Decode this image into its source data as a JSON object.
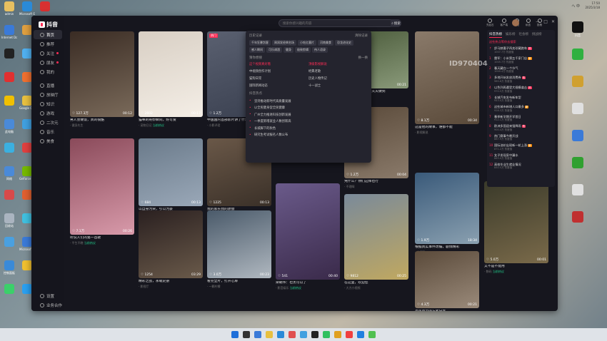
{
  "desktop": {
    "left_icons": [
      {
        "label": "admin",
        "color": "#e8c060"
      },
      {
        "label": "Internet Downlo",
        "color": "#3a7ad8"
      },
      {
        "label": "",
        "color": "#222"
      },
      {
        "label": "",
        "color": "#e03030"
      },
      {
        "label": "",
        "color": "#f0c000"
      },
      {
        "label": "此电脑",
        "color": "#4a8ad8"
      },
      {
        "label": "",
        "color": "#3bb0e0"
      },
      {
        "label": "网络",
        "color": "#4a8ad8"
      },
      {
        "label": "",
        "color": "#d84a4a"
      },
      {
        "label": "回收站",
        "color": "#aab4c0"
      },
      {
        "label": "",
        "color": "#4aa0e0"
      },
      {
        "label": "控制面板",
        "color": "#3a8ad8"
      },
      {
        "label": "",
        "color": "#3bd06a"
      },
      {
        "label": "Microsoft Edge",
        "color": "#2a8ad8"
      },
      {
        "label": "",
        "color": "#e0a040"
      },
      {
        "label": "",
        "color": "#50b0f0"
      },
      {
        "label": "",
        "color": "#f07030"
      },
      {
        "label": "Google Chrome",
        "color": "#e8c040"
      },
      {
        "label": "",
        "color": "#40a0e0"
      },
      {
        "label": "",
        "color": "#e04040"
      },
      {
        "label": "GeForce Experience",
        "color": "#76b900"
      },
      {
        "label": "",
        "color": "#e06030"
      },
      {
        "label": "",
        "color": "#40c0e0"
      },
      {
        "label": "Microsoft Store",
        "color": "#3a7ad8"
      },
      {
        "label": "",
        "color": "#f0c030"
      },
      {
        "label": "",
        "color": "#2aa0f0"
      },
      {
        "label": "",
        "color": "#d83030"
      },
      {
        "label": "",
        "color": "#e0e0e0"
      },
      {
        "label": "",
        "color": "#20c060"
      },
      {
        "label": "",
        "color": "#f0c000"
      },
      {
        "label": "",
        "color": "#3a7ad8"
      },
      {
        "label": "",
        "color": "#2ac080"
      },
      {
        "label": "GAME管家",
        "color": "#e0a020"
      }
    ],
    "right_icons": [
      {
        "label": "抖音",
        "color": "#111"
      },
      {
        "label": "",
        "color": "#30b040"
      },
      {
        "label": "",
        "color": "#d0a030"
      },
      {
        "label": "",
        "color": "#e0e0e0"
      },
      {
        "label": "",
        "color": "#3a7ad8"
      },
      {
        "label": "",
        "color": "#30a030"
      },
      {
        "label": "",
        "color": "#e0e0e0"
      },
      {
        "label": "",
        "color": "#c03030"
      }
    ]
  },
  "app": {
    "logo_text": "抖音",
    "nav": [
      {
        "label": "首页",
        "active": true
      },
      {
        "label": "推荐",
        "active": false
      },
      {
        "label": "关注",
        "active": false,
        "dot": true
      },
      {
        "label": "朋友",
        "active": false,
        "dot": true
      },
      {
        "label": "我的",
        "active": false
      },
      {
        "label": "直播",
        "active": false
      },
      {
        "label": "放映厅",
        "active": false
      },
      {
        "label": "知识",
        "active": false
      },
      {
        "label": "游戏",
        "active": false
      },
      {
        "label": "二次元",
        "active": false
      },
      {
        "label": "音乐",
        "active": false
      },
      {
        "label": "美食",
        "active": false
      }
    ],
    "nav_bottom": [
      {
        "label": "设置"
      },
      {
        "label": "业务合作"
      }
    ],
    "search": {
      "placeholder": "搜索你感兴趣的内容",
      "button": "搜索"
    },
    "top_icons": [
      "充钻石",
      "客户端",
      "通知",
      "私信",
      "投稿"
    ],
    "window_controls": [
      "—",
      "□",
      "✕"
    ],
    "dropdown": {
      "history_title": "历史记录",
      "clear": "清除记录",
      "history": [
        "千年狂暴剑客",
        "周润发经典名场",
        "小吃红墨片",
        "河南美食",
        "恐龙进化史",
        "感人瞬间",
        "可乐调酒",
        "健身",
        "极致剪辑",
        "伟人语录"
      ],
      "guess_title": "猜你想搜",
      "refresh": "换一换",
      "guess": [
        {
          "text": "这个视频真好看",
          "red": true
        },
        {
          "text": "顶级影视解说",
          "red": true
        },
        {
          "text": "中视频创作计划",
          "red": false
        },
        {
          "text": "经典老歌",
          "red": false
        },
        {
          "text": "猫狗日常",
          "red": false
        },
        {
          "text": "历史人物传记",
          "red": false
        },
        {
          "text": "国际新闻动态",
          "red": false
        },
        {
          "text": "十一战士",
          "red": false
        }
      ],
      "hot_title": "抖音热点",
      "hot": [
        "坚持推动新时代高质量发展",
        "以全民健身促全民健康",
        "广州全力推进科技创新发展",
        "一季度新增就业人数创新高",
        "长城脚下的秋色",
        "研究生考试报名人数公布"
      ]
    },
    "right_panel": {
      "tabs": [
        "抖音热榜",
        "娱乐榜",
        "社会榜",
        "挑战榜"
      ],
      "search_label": "这些热点等你去搜索",
      "items": [
        {
          "n": "↑",
          "t": "舒马赫妻子再卖珍藏跑车",
          "h": "1007.7万 热度值",
          "tag": "hot"
        },
        {
          "n": "1",
          "t": "雷军：小米第五千家门店",
          "h": "1005.7万 热度值",
          "tag": "new"
        },
        {
          "n": "2",
          "t": "春天藏在一个节气",
          "h": "1000.4万 热度值",
          "tag": ""
        },
        {
          "n": "3",
          "t": "多地开始发放消费券",
          "h": "985.6万 热度值",
          "tag": "hot"
        },
        {
          "n": "4",
          "t": "以色列再遭受大规模袭击",
          "h": "970.5万 热度值",
          "tag": "hot"
        },
        {
          "n": "5",
          "t": "长城汽车发布新车型",
          "h": "943.0万 热度值",
          "tag": ""
        },
        {
          "n": "6",
          "t": "这些城市新增人口最多",
          "h": "928.3万 热度值",
          "tag": "new"
        },
        {
          "n": "7",
          "t": "春季新学期开学首日",
          "h": "912.1万 热度值",
          "tag": ""
        },
        {
          "n": "8",
          "t": "欧洲多国迎来强降雨",
          "h": "900.4万 热度值",
          "tag": "hot"
        },
        {
          "n": "9",
          "t": "热门赛事今晚开战",
          "h": "887.9万 热度值",
          "tag": ""
        },
        {
          "n": "10",
          "t": "国际油价出现新一轮上涨",
          "h": "871.2万 热度值",
          "tag": "new"
        },
        {
          "n": "11",
          "t": "女子发现家中漏水",
          "h": "863.0万 热度值",
          "tag": ""
        },
        {
          "n": "12",
          "t": "高校毕业生就业情况",
          "h": "850.5万 热度值",
          "tag": ""
        }
      ]
    },
    "watermark": "ID970404",
    "cards": [
      {
        "likes": "♡ 127.3万",
        "dur": "00:12",
        "title": "男人会做饭，真的很酷",
        "meta": "· 健身先生",
        "hot": "",
        "badge": ""
      },
      {
        "likes": "♡ 2602",
        "dur": "00:17",
        "title": "猫咪的奇妙瞬间，好可爱",
        "meta": "· 宠物日记",
        "hot": "当前热议",
        "badge": ""
      },
      {
        "likes": "♡ 1.2万",
        "dur": "00:21",
        "title": "中国国内首部影片讲了什么",
        "meta": "· 小影评君",
        "hot": "",
        "badge": "热门"
      },
      {
        "likes": "♡ 7.1万",
        "dur": "00:26",
        "title": "听说人们的第一首歌",
        "meta": "· 平生不晚",
        "hot": "当前热议",
        "badge": ""
      },
      {
        "likes": "♡ 684",
        "dur": "00:13",
        "title": "以自身为荣，引以为豪",
        "meta": "· 小家庭",
        "hot": "",
        "badge": ""
      },
      {
        "likes": "♡ 1225",
        "dur": "00:13",
        "title": "我的家长我的骄傲",
        "meta": "· 晨读",
        "hot": "",
        "badge": ""
      },
      {
        "likes": "♡ 1254",
        "dur": "03:29",
        "title": "精彩之战，永载史册",
        "meta": "· 影视厅",
        "hot": "",
        "badge": ""
      },
      {
        "likes": "♡ 3.0万",
        "dur": "00:23",
        "title": "看完全片，打开心扉",
        "meta": "· 一颗柠檬",
        "hot": "",
        "badge": ""
      },
      {
        "likes": "♡ 541",
        "dur": "00:40",
        "title": "梁朝伟：也太可以了",
        "meta": "· 影音娱乐",
        "hot": "当前热议",
        "badge": ""
      },
      {
        "likes": "♡ 1.2万",
        "dur": "00:04",
        "title": "凭什么？你们这样也行",
        "meta": "· 不理睬",
        "hot": "",
        "badge": ""
      },
      {
        "likes": "♡ 9812",
        "dur": "00:25",
        "title": "在这里，欢迎您",
        "meta": "· 大力小视频",
        "hot": "",
        "badge": ""
      },
      {
        "likes": "♡ 5.2万",
        "dur": "00:21",
        "title": "战争片：我们不是天天做到",
        "meta": "· 军事频道",
        "hot": "",
        "badge": ""
      },
      {
        "likes": "♡ 8.1万",
        "dur": "00:34",
        "title": "这是他的故事，谁都不能",
        "meta": "· 影视解说",
        "hot": "",
        "badge": ""
      },
      {
        "likes": "♡ 45.9万",
        "dur": "00:18",
        "title": "这是人类历史上的大灾难",
        "meta": "· 历史频道",
        "hot": "",
        "badge": "推荐"
      },
      {
        "likes": "♡ 1.9万",
        "dur": "18:34",
        "title": "根据真实事件改编，剧情精彩",
        "meta": "· 金沉默",
        "hot": "",
        "badge": ""
      },
      {
        "likes": "♡ 4.3万",
        "dur": "00:21",
        "title": "高风亮节的方式分享",
        "meta": "· 电视剧",
        "hot": "",
        "badge": ""
      },
      {
        "likes": "♡ 5.0万",
        "dur": "00:01",
        "title": "又不是不能用",
        "meta": "· 数码",
        "hot": "当前热议",
        "badge": ""
      }
    ]
  },
  "taskbar": {
    "icons": [
      "#1e6fd9",
      "#333",
      "#3a7ad8",
      "#e8c040",
      "#2a8ad8",
      "#e05050",
      "#40a0e0",
      "#222",
      "#30c060",
      "#e0a020",
      "#f04040",
      "#2080e0",
      "#50c050"
    ],
    "tray": "へ  中",
    "time": "17:50",
    "date": "2025/3/18"
  }
}
